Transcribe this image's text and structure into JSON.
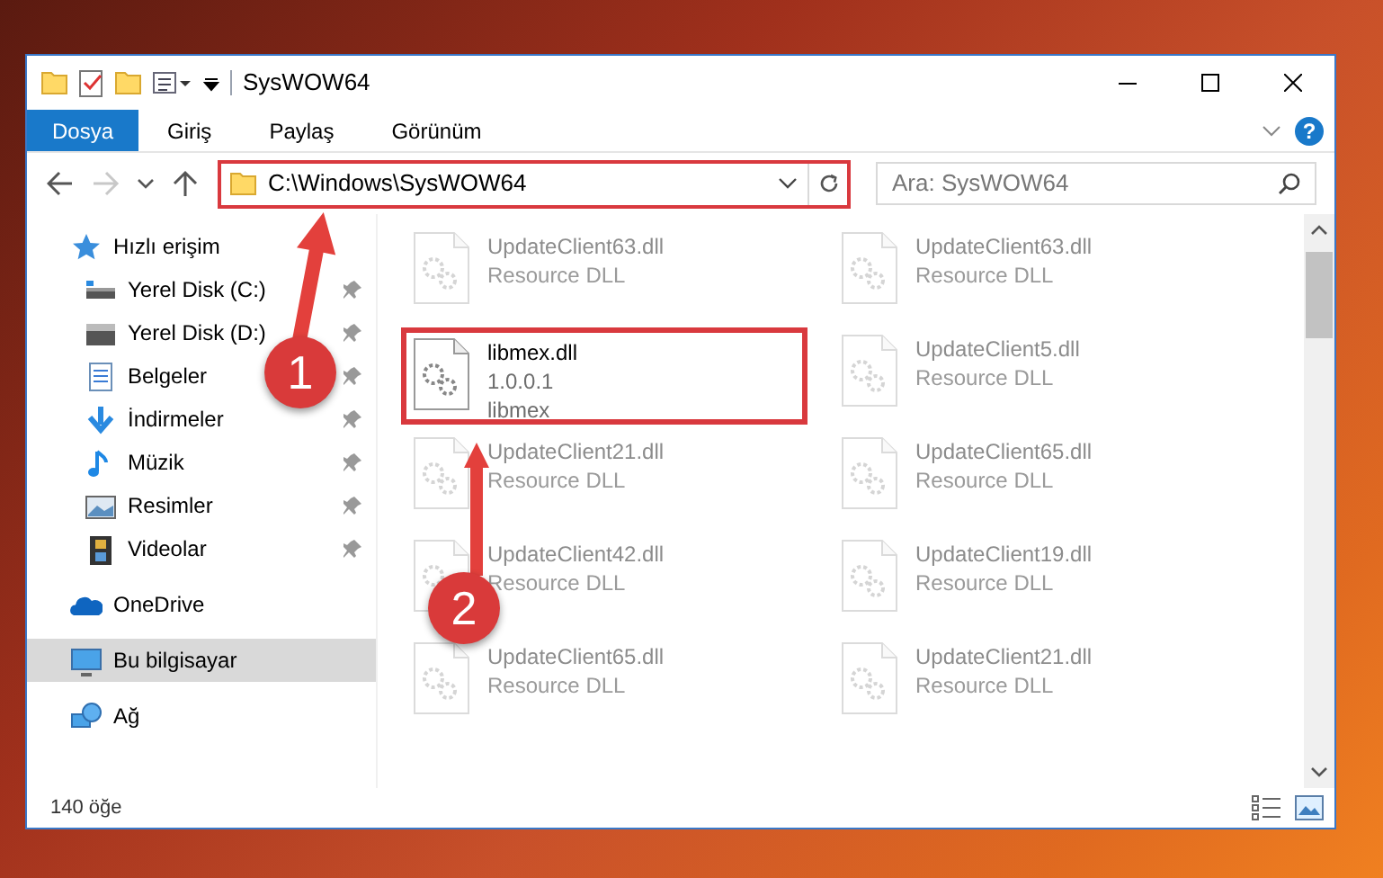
{
  "window": {
    "title": "SysWOW64"
  },
  "ribbon": {
    "tabs": [
      {
        "label": "Dosya",
        "selected": true
      },
      {
        "label": "Giriş",
        "selected": false
      },
      {
        "label": "Paylaş",
        "selected": false
      },
      {
        "label": "Görünüm",
        "selected": false
      }
    ]
  },
  "navigation": {
    "buttons": [
      {
        "kind": "back",
        "disabled": false
      },
      {
        "kind": "forward",
        "disabled": true
      },
      {
        "kind": "recent",
        "disabled": false
      },
      {
        "kind": "up",
        "disabled": false
      }
    ]
  },
  "address": {
    "path": "C:\\Windows\\SysWOW64",
    "highlighted": true
  },
  "help": {
    "label": "?"
  },
  "search": {
    "placeholder": "Ara: SysWOW64"
  },
  "sidebar": {
    "items": [
      {
        "label": "Hızlı erişim",
        "kind": "star",
        "selected": false,
        "children": [
          {
            "label": "Yerel Disk (C:)",
            "kind": "drive-c",
            "pinned": true
          },
          {
            "label": "Yerel Disk (D:)",
            "kind": "drive",
            "pinned": true
          },
          {
            "label": "Belgeler",
            "kind": "document",
            "pinned": true
          },
          {
            "label": "İndirmeler",
            "kind": "download",
            "pinned": true
          },
          {
            "label": "Müzik",
            "kind": "music",
            "pinned": true
          },
          {
            "label": "Resimler",
            "kind": "picture",
            "pinned": true
          },
          {
            "label": "Videolar",
            "kind": "video",
            "pinned": true
          }
        ]
      },
      {
        "label": "OneDrive",
        "kind": "cloud",
        "selected": false
      },
      {
        "label": "Bu bilgisayar",
        "kind": "computer",
        "selected": true
      },
      {
        "label": "Ağ",
        "kind": "network",
        "selected": false
      }
    ]
  },
  "files": [
    {
      "name": "UpdateClient63.dll",
      "line_2": "Resource DLL",
      "blurred": true,
      "highlighted": false
    },
    {
      "name": "UpdateClient63.dll",
      "line_2": "Resource DLL",
      "blurred": true,
      "highlighted": false
    },
    {
      "name": "libmex.dll",
      "line_2": "1.0.0.1",
      "line_3": "libmex",
      "blurred": false,
      "highlighted": true
    },
    {
      "name": "UpdateClient5.dll",
      "line_2": "Resource DLL",
      "blurred": true,
      "highlighted": false
    },
    {
      "name": "UpdateClient21.dll",
      "line_2": "Resource DLL",
      "blurred": true,
      "highlighted": false
    },
    {
      "name": "UpdateClient65.dll",
      "line_2": "Resource DLL",
      "blurred": true,
      "highlighted": false
    },
    {
      "name": "UpdateClient42.dll",
      "line_2": "Resource DLL",
      "blurred": true,
      "highlighted": false
    },
    {
      "name": "UpdateClient19.dll",
      "line_2": "Resource DLL",
      "blurred": true,
      "highlighted": false
    },
    {
      "name": "UpdateClient65.dll",
      "line_2": "Resource DLL",
      "blurred": true,
      "highlighted": false
    },
    {
      "name": "UpdateClient21.dll",
      "line_2": "Resource DLL",
      "blurred": true,
      "highlighted": false
    }
  ],
  "status_bar": {
    "count": "140 öğe"
  },
  "callouts": [
    {
      "number": "1"
    },
    {
      "number": "2"
    }
  ]
}
